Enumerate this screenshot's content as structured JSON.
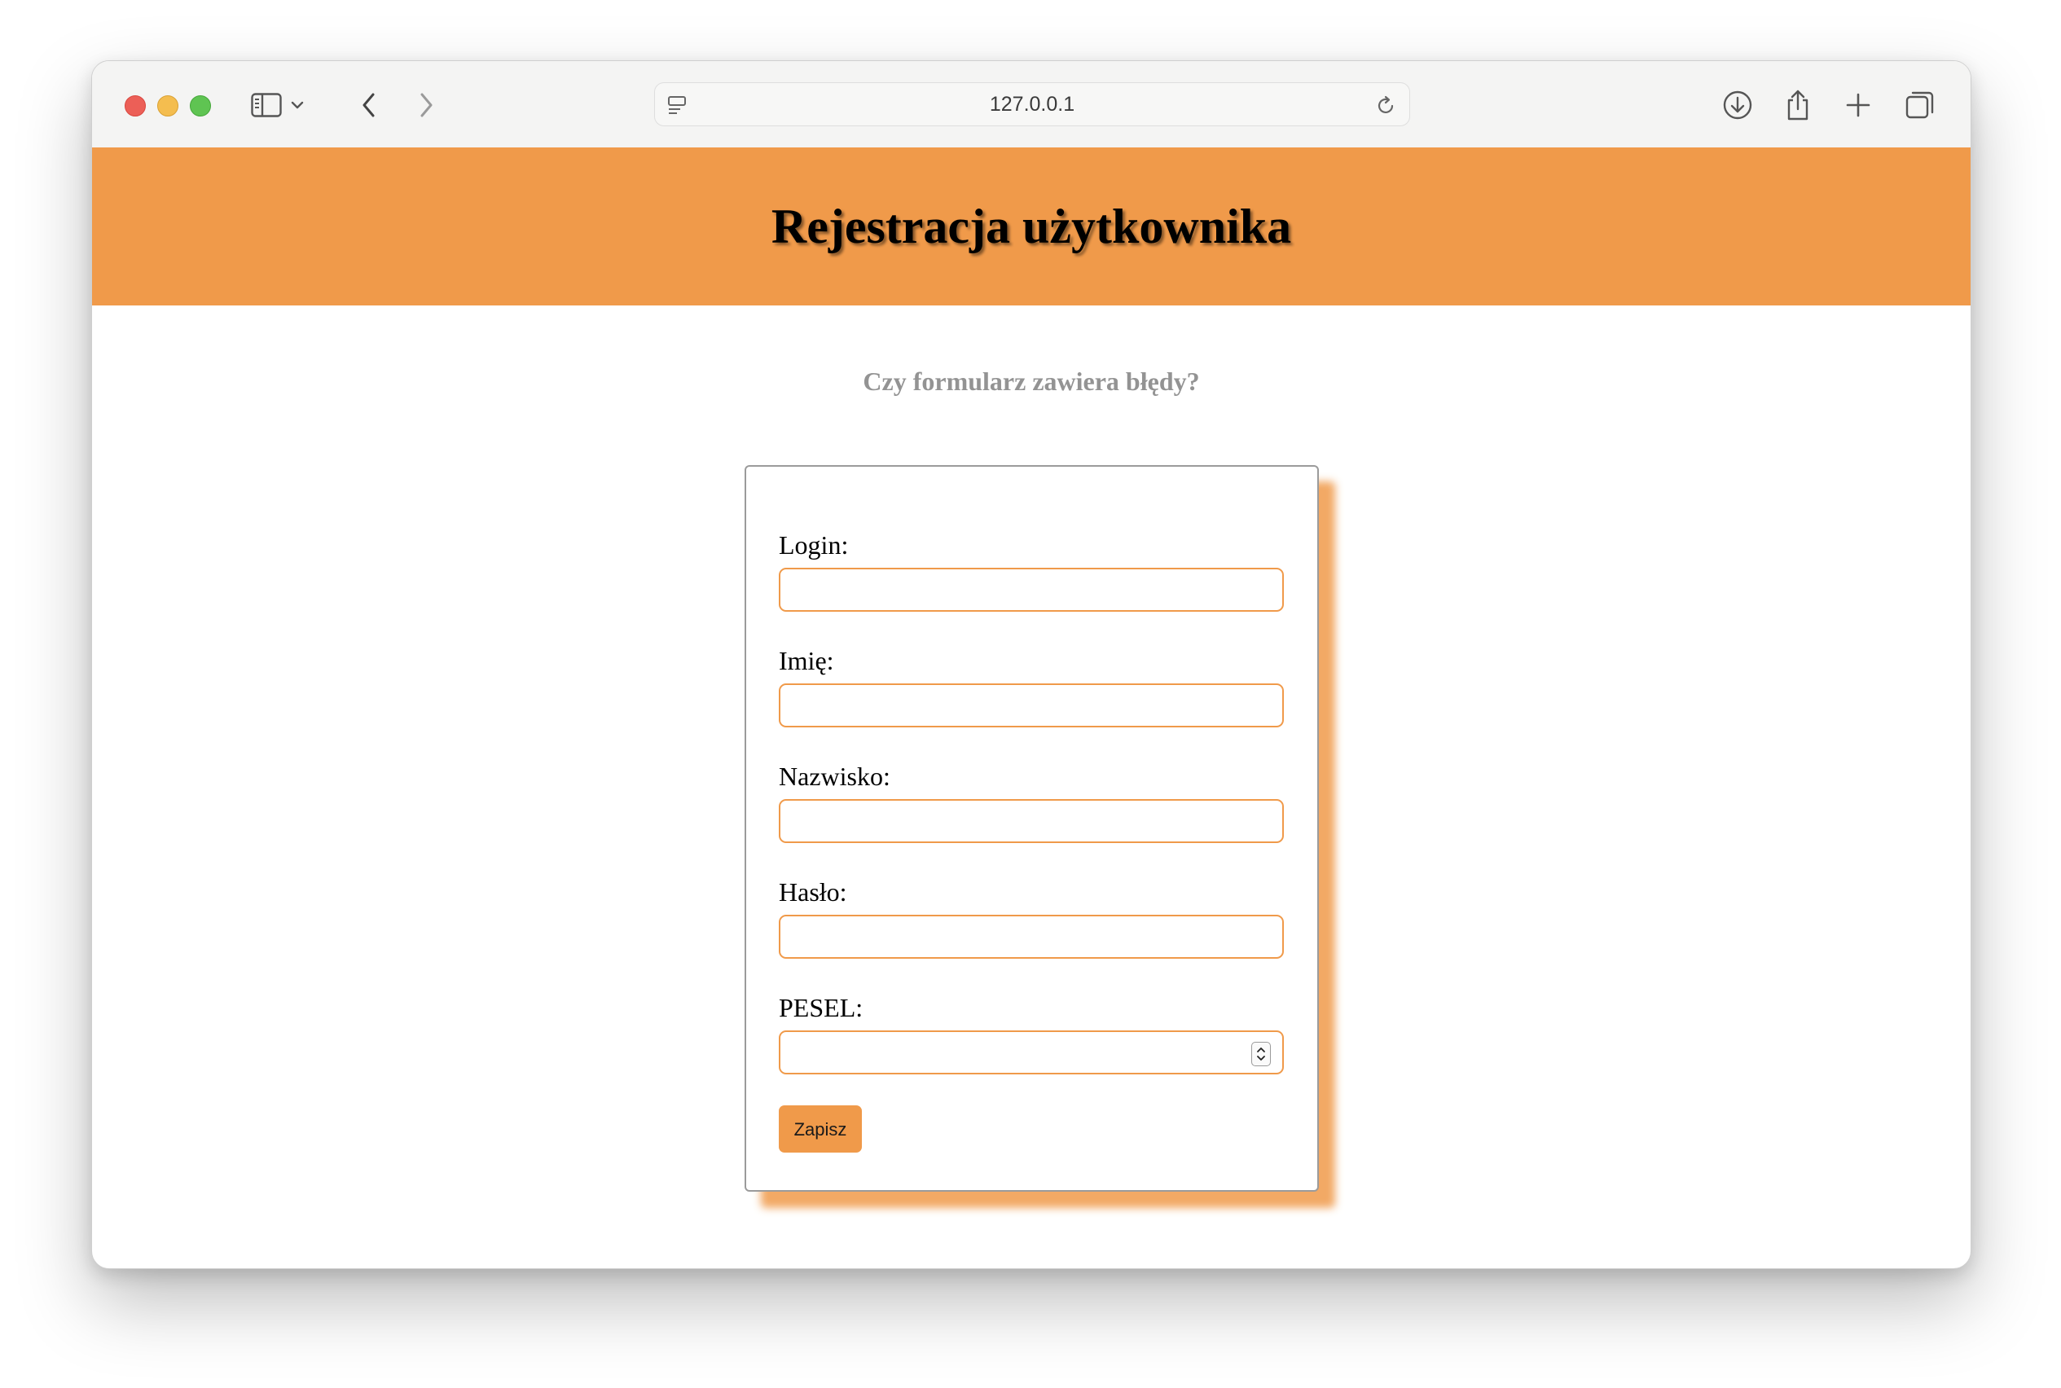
{
  "browser": {
    "url": "127.0.0.1"
  },
  "page": {
    "title": "Rejestracja użytkownika",
    "subtitle": "Czy formularz zawiera błędy?"
  },
  "form": {
    "fields": [
      {
        "label": "Login:",
        "value": ""
      },
      {
        "label": "Imię:",
        "value": ""
      },
      {
        "label": "Nazwisko:",
        "value": ""
      },
      {
        "label": "Hasło:",
        "value": ""
      },
      {
        "label": "PESEL:",
        "value": ""
      }
    ],
    "submit_label": "Zapisz"
  },
  "colors": {
    "accent": "#f09a4a",
    "subtitle": "#939393"
  }
}
